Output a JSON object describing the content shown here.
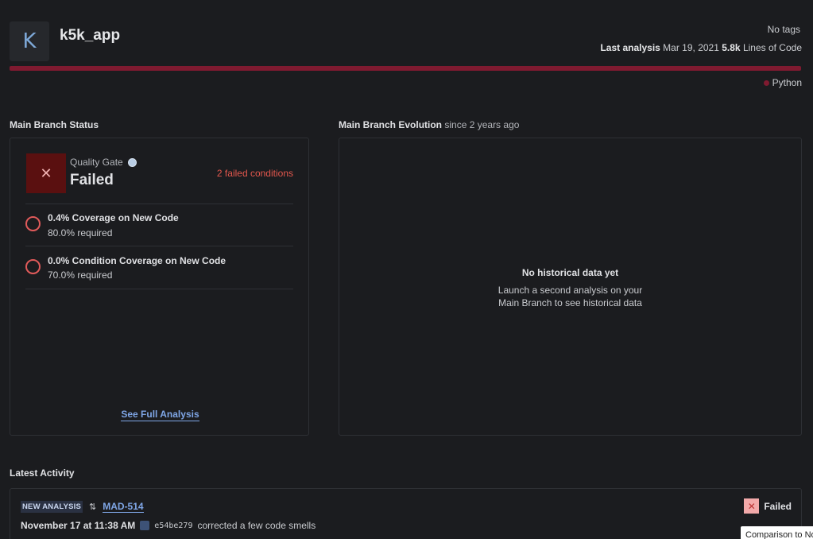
{
  "header": {
    "avatar_letter": "K",
    "project_name": "k5k_app",
    "tags": "No tags",
    "last_analysis_label": "Last analysis",
    "last_analysis_date": "Mar 19, 2021",
    "loc_value": "5.8k",
    "loc_label": "Lines of Code",
    "language": "Python",
    "language_color": "#7f1a30"
  },
  "branch_status": {
    "title": "Main Branch Status",
    "quality_gate_label": "Quality Gate",
    "quality_gate_status": "Failed",
    "failed_conditions": "2 failed conditions",
    "conditions": [
      {
        "title": "0.4% Coverage on New Code",
        "required": "80.0% required"
      },
      {
        "title": "0.0% Condition Coverage on New Code",
        "required": "70.0% required"
      }
    ],
    "see_full": "See Full Analysis"
  },
  "evolution": {
    "title": "Main Branch Evolution",
    "since": "since 2 years ago",
    "empty_title": "No historical data yet",
    "empty_line1": "Launch a second analysis on your",
    "empty_line2": "Main Branch to see historical data"
  },
  "activity": {
    "title": "Latest Activity",
    "badge": "NEW ANALYSIS",
    "branch": "MAD-514",
    "date": "November 17 at 11:38 AM",
    "commit_hash": "e54be279",
    "commit_message": "corrected a few code smells",
    "status": "Failed"
  },
  "tooltip": "Comparison to Nor"
}
